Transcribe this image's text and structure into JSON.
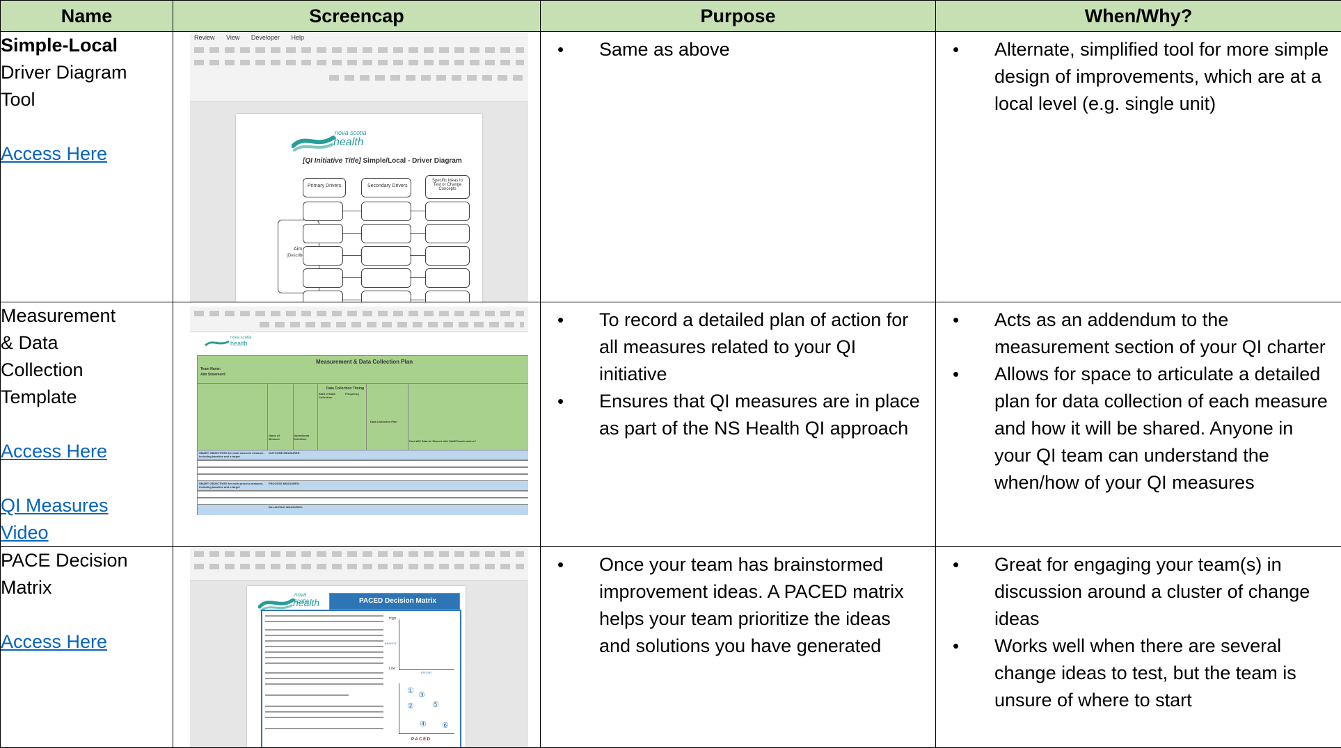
{
  "headers": {
    "name": "Name",
    "screencap": "Screencap",
    "purpose": "Purpose",
    "when": "When/Why?"
  },
  "rows": [
    {
      "name_bold": "Simple-Local",
      "name_rest": [
        "Driver Diagram",
        "Tool"
      ],
      "links": [
        "Access Here"
      ],
      "purpose": [
        "Same as above"
      ],
      "when": [
        "Alternate, simplified tool for more simple design of improvements, which are at a local level (e.g. single unit)"
      ],
      "screencap": {
        "menu": [
          "Review",
          "View",
          "Developer",
          "Help"
        ],
        "logo_small": "nova scotia",
        "logo_big": "health",
        "doc_title_italic": "[QI Initiative Title]",
        "doc_title": " Simple/Local - Driver Diagram",
        "col1": "Primary Drivers",
        "col2": "Secondary Drivers",
        "col3": "Specific Ideas to Test or Change Concepts",
        "aim": "Aim",
        "aim_sub": "(Describe)"
      }
    },
    {
      "name_lines": [
        "Measurement",
        "& Data",
        "Collection",
        "Template"
      ],
      "links": [
        "Access Here",
        "QI Measures",
        "Video"
      ],
      "purpose": [
        "To record a detailed plan of action for all measures related to your QI initiative",
        "Ensures that QI measures are in place as part of the NS Health QI approach"
      ],
      "when": [
        "Acts as an addendum to the measurement section of your QI charter",
        "Allows for space to articulate a detailed plan for data collection of each measure and how it will be shared. Anyone in your QI team can understand the when/how of your QI measures"
      ],
      "screencap": {
        "logo_small": "nova scotia",
        "logo_big": "health",
        "sheet_title": "Measurement & Data Collection Plan",
        "team": "Team Name:",
        "aim": "Aim Statement:",
        "timing": "Data Collection Timing",
        "start": "Start of Data Collection",
        "freq": "Frequency",
        "plan": "Data Collection Plan",
        "name_measure": "Name of Measure",
        "op_def": "Operational Definition",
        "shared": "How Will Data be Shared with Staff/Team/Leaders?",
        "smart1": "SMART OBJECTIVES for each outcome measure, including baseline and a target",
        "outcome": "OUTCOME MEASURES:",
        "smart2": "SMART OBJECTIVES for each process measure, including baseline and a target",
        "process": "PROCESS MEASURES:",
        "balancing": "BALANCING MEASURES:"
      }
    },
    {
      "name_lines": [
        "PACE Decision",
        "Matrix"
      ],
      "links": [
        "Access Here"
      ],
      "purpose": [
        "Once your team has brainstormed improvement ideas. A PACED matrix helps your team prioritize the ideas and solutions you have generated"
      ],
      "when": [
        "Great for engaging your team(s) in discussion around a cluster of change ideas",
        "Works well when there are several change ideas to test, but the team is unsure of where to start"
      ],
      "screencap": {
        "logo_small": "nova scotia",
        "logo_big": "health",
        "title": "PACED Decision Matrix",
        "high": "High",
        "low": "Low",
        "effort": "EFFORT",
        "benefit": "BENEFIT",
        "paced": "P A C E D"
      }
    }
  ],
  "colors": {
    "header_bg": "#c6e0b4",
    "link": "#0563c1",
    "nsh_teal": "#2a9d9a"
  }
}
